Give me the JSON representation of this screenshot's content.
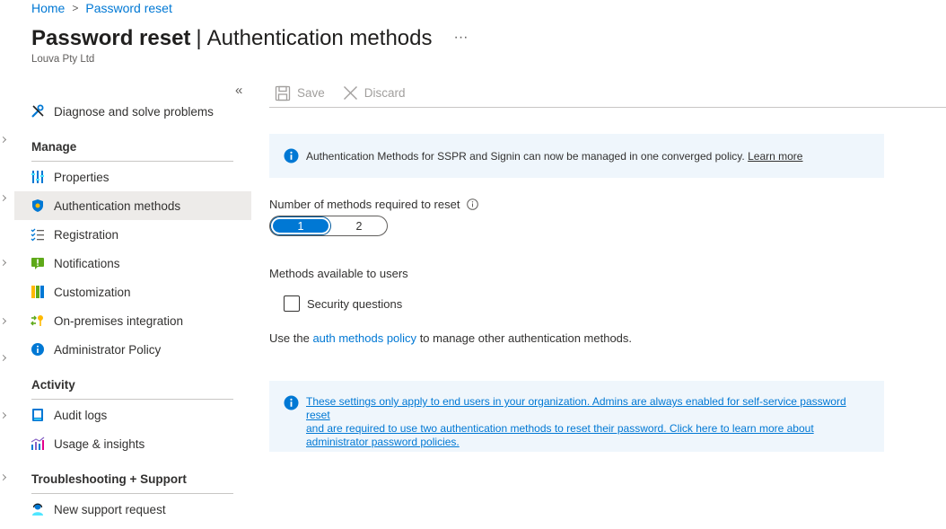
{
  "breadcrumb": {
    "home": "Home",
    "separator": ">",
    "current": "Password reset"
  },
  "header": {
    "title_main": "Password reset",
    "title_separator": "|",
    "title_sub": "Authentication methods",
    "more": "···",
    "org": "Louva Pty Ltd"
  },
  "sidebar": {
    "collapse": "«",
    "diagnose": {
      "label": "Diagnose and solve problems",
      "icon": "wrench-icon"
    },
    "manage_title": "Manage",
    "manage_items": [
      {
        "label": "Properties",
        "icon": "properties-icon"
      },
      {
        "label": "Authentication methods",
        "icon": "shield-icon",
        "active": true
      },
      {
        "label": "Registration",
        "icon": "checklist-icon"
      },
      {
        "label": "Notifications",
        "icon": "notification-icon"
      },
      {
        "label": "Customization",
        "icon": "palette-icon"
      },
      {
        "label": "On-premises integration",
        "icon": "sync-key-icon"
      },
      {
        "label": "Administrator Policy",
        "icon": "info-icon"
      }
    ],
    "activity_title": "Activity",
    "activity_items": [
      {
        "label": "Audit logs",
        "icon": "book-icon"
      },
      {
        "label": "Usage & insights",
        "icon": "chart-icon"
      }
    ],
    "support_title": "Troubleshooting + Support",
    "support_items": [
      {
        "label": "New support request",
        "icon": "support-person-icon"
      }
    ]
  },
  "toolbar": {
    "save": "Save",
    "discard": "Discard"
  },
  "banner_top": {
    "text": "Authentication Methods for SSPR and Signin can now be managed in one converged policy.",
    "link": "Learn more"
  },
  "methods_required": {
    "label": "Number of methods required to reset",
    "options": [
      "1",
      "2"
    ],
    "selected": "1"
  },
  "methods_available": {
    "label": "Methods available to users",
    "security_questions": "Security questions",
    "checked": false
  },
  "policy": {
    "prefix": "Use the",
    "link": "auth methods policy",
    "suffix": "to manage other authentication methods."
  },
  "banner_bottom": {
    "line1": "These settings only apply to end users in your organization. Admins are always enabled for self-service password reset",
    "line2": "and are required to use two authentication methods to reset their password. Click here to learn more about",
    "line3": "administrator password policies."
  },
  "colors": {
    "accent": "#0078d4",
    "banner_bg": "#eff6fc",
    "active_nav": "#edebe9"
  }
}
